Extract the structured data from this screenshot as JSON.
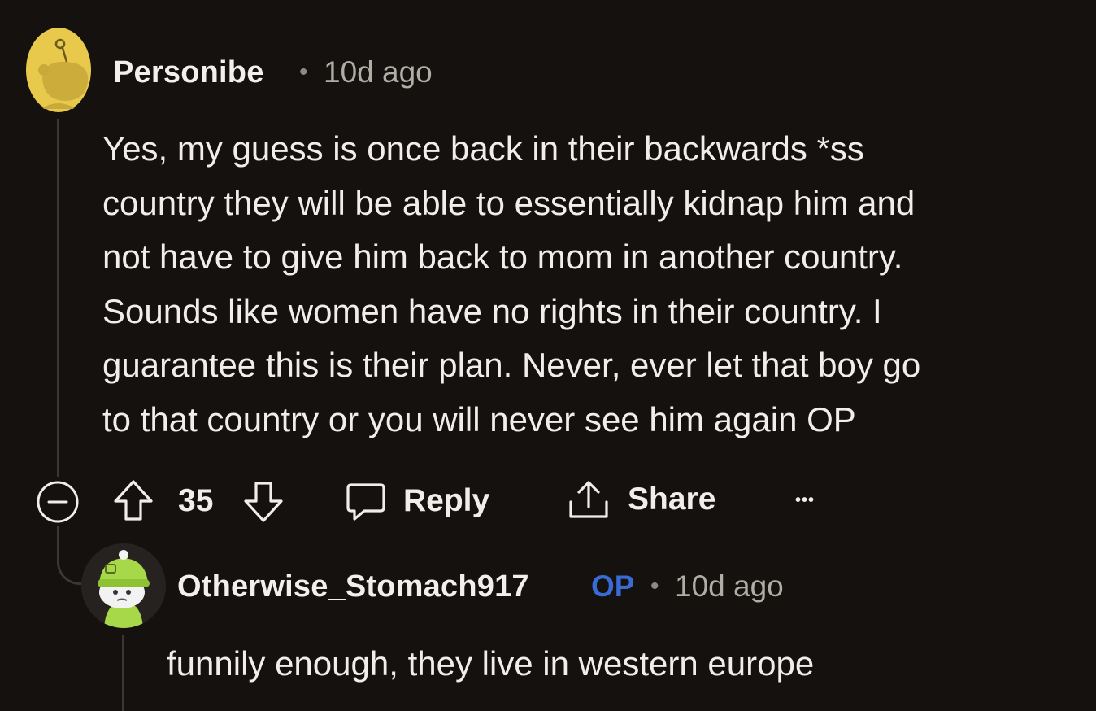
{
  "comments": [
    {
      "author": "Personibe",
      "separator": "•",
      "time": "10d ago",
      "body": "Yes, my guess is once back in their backwards *ss\ncountry they will be able to essentially kidnap him and\nnot have to give him back to mom in another country.\nSounds like women have no rights in their country. I\nguarantee this is their plan. Never, ever let that boy go\nto that country or you will never see him again OP",
      "actions": {
        "collapse_icon": "minus-circle-icon",
        "upvote_icon": "upvote-arrow-icon",
        "score": "35",
        "downvote_icon": "downvote-arrow-icon",
        "reply_label": "Reply",
        "share_label": "Share",
        "more_label": "•••"
      }
    },
    {
      "author": "Otherwise_Stomach917",
      "op_badge": "OP",
      "separator": "•",
      "time": "10d ago",
      "body": "funnily enough, they live in western europe"
    }
  ],
  "colors": {
    "background": "#14110e",
    "op_badge": "#3a6ad6",
    "thread_line": "#3a3835"
  }
}
